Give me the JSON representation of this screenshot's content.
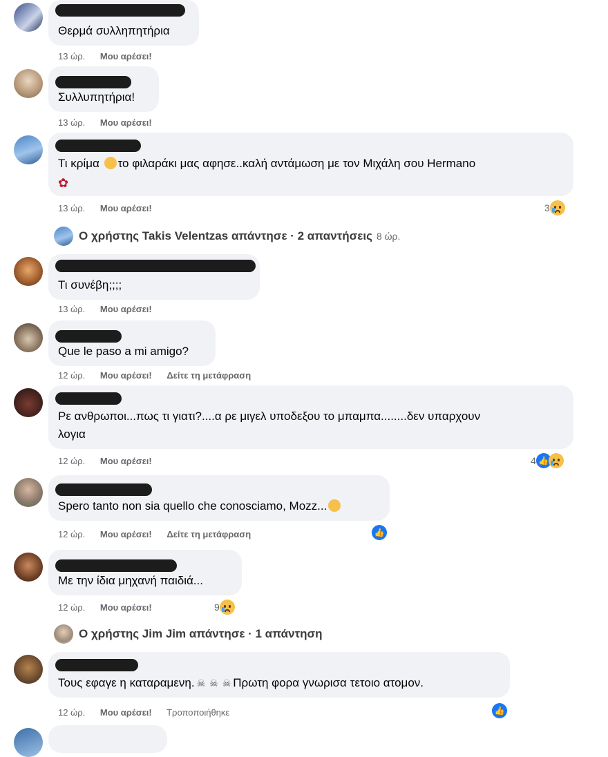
{
  "colors": {
    "bubble": "#f0f2f5",
    "meta_text": "#65676b",
    "like_blue": "#1877f2",
    "redaction": "#1c1c1c"
  },
  "comments": [
    {
      "text": "Θερμά συλληπητήρια",
      "time": "13 ώρ.",
      "like": "Μου αρέσει!"
    },
    {
      "text": "Συλλυπητήρια!",
      "time": "13 ώρ.",
      "like": "Μου αρέσει!"
    },
    {
      "text_1": "Τι κρίμα",
      "text_2": "το φιλαράκι μας αφησε..καλή αντάμωση με τον Μιχάλη σου Hermano",
      "time": "13 ώρ.",
      "like": "Μου αρέσει!",
      "reaction_count": "3",
      "reaction_icon": "sad-emoji-icon"
    },
    {
      "text": "Τι συνέβη;;;;",
      "time": "13 ώρ.",
      "like": "Μου αρέσει!"
    },
    {
      "text": "Que le paso a mi amigo?",
      "time": "12 ώρ.",
      "like": "Μου αρέσει!",
      "extra": "Δείτε τη μετάφραση"
    },
    {
      "text_1": "Ρε ανθρωποι...πως τι γιατι?....α ρε μιγελ υποδεξου το μπαμπα........δεν υπαρχουν",
      "text_2": "λογια",
      "time": "12 ώρ.",
      "like": "Μου αρέσει!",
      "reaction_count": "4"
    },
    {
      "text": "Spero tanto non sia quello che conosciamo, Mozz...",
      "time": "12 ώρ.",
      "like": "Μου αρέσει!",
      "extra": "Δείτε τη μετάφραση"
    },
    {
      "text": "Με την ίδια μηχανή παιδιά...",
      "time": "12 ώρ.",
      "like": "Μου αρέσει!",
      "reaction_count": "9"
    },
    {
      "text_1": "Τους εφαγε η καταραμενη.",
      "text_2": "Πρωτη φορα γνωρισα τετοιο ατομον.",
      "time": "12 ώρ.",
      "like": "Μου αρέσει!",
      "extra": "Τροποποιήθηκε"
    }
  ],
  "replies": [
    {
      "text": "Ο χρήστης Takis Velentzas απάντησε · 2 απαντήσεις",
      "time": "8 ώρ."
    },
    {
      "text": "Ο χρήστης Jim Jim απάντησε · 1 απάντηση"
    }
  ]
}
